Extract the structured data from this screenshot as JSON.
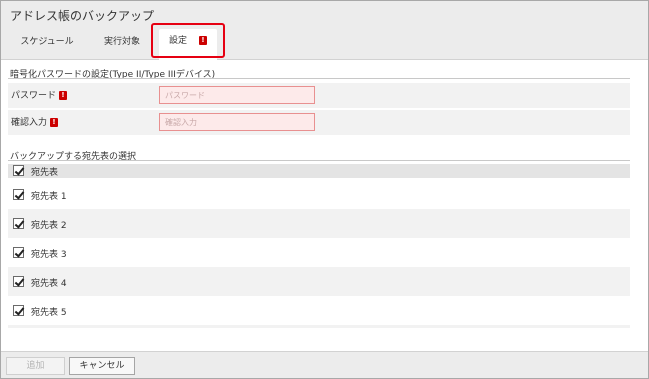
{
  "dialog": {
    "title": "アドレス帳のバックアップ"
  },
  "tabs": [
    {
      "label": "スケジュール",
      "active": false
    },
    {
      "label": "実行対象",
      "active": false
    },
    {
      "label": "設定",
      "active": true,
      "required_mark": "!"
    }
  ],
  "password_section": {
    "title": "暗号化パスワードの設定(Type II/Type IIIデバイス)",
    "password": {
      "label": "パスワード",
      "required_mark": "!",
      "placeholder": "パスワード",
      "value": ""
    },
    "confirm": {
      "label": "確認入力",
      "required_mark": "!",
      "placeholder": "確認入力",
      "value": ""
    }
  },
  "addressbook_section": {
    "title": "バックアップする宛先表の選択",
    "header": {
      "label": "宛先表",
      "checked": true
    },
    "items": [
      {
        "label": "宛先表 1",
        "checked": true
      },
      {
        "label": "宛先表 2",
        "checked": true
      },
      {
        "label": "宛先表 3",
        "checked": true
      },
      {
        "label": "宛先表 4",
        "checked": true
      },
      {
        "label": "宛先表 5",
        "checked": true
      }
    ]
  },
  "footer": {
    "add_label": "追加",
    "add_enabled": false,
    "cancel_label": "キャンセル"
  },
  "colors": {
    "highlight": "#e60012",
    "required": "#cc0000",
    "input_error_bg": "#fdeaea",
    "input_error_border": "#e89090"
  }
}
